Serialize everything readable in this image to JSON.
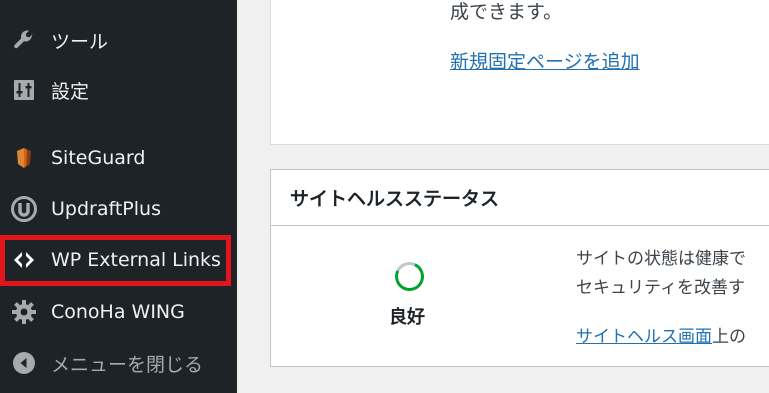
{
  "sidebar": {
    "items": [
      {
        "label": "ツール",
        "icon": "wrench-icon"
      },
      {
        "label": "設定",
        "icon": "settings-sliders-icon"
      },
      {
        "label": "SiteGuard",
        "icon": "siteguard-shield-icon"
      },
      {
        "label": "UpdraftPlus",
        "icon": "updraftplus-icon"
      },
      {
        "label": "WP External Links",
        "icon": "external-links-icon"
      },
      {
        "label": "ConoHa WING",
        "icon": "gear-icon"
      },
      {
        "label": "メニューを閉じる",
        "icon": "collapse-menu-icon"
      }
    ],
    "highlight_color": "#e2141e"
  },
  "main": {
    "top_card": {
      "text": "成できます。",
      "link": "新規固定ページを追加"
    },
    "site_health": {
      "title": "サイトヘルスステータス",
      "status": "良好",
      "desc_line1": "サイトの状態は健康で",
      "desc_line2": "セキュリティを改善す",
      "desc_link": "サイトヘルス画面",
      "desc_after_link": "上の"
    }
  }
}
